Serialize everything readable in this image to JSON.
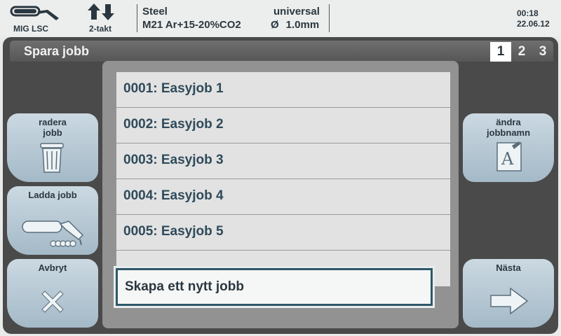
{
  "status_bar": {
    "process_mode": "MIG LSC",
    "trigger_mode": "2-takt",
    "material": "Steel",
    "gas": "M21 Ar+15-20%CO2",
    "program": "universal",
    "wire_symbol": "Ø",
    "wire_diameter": "1.0mm",
    "time": "00:18",
    "date": "22.06.12"
  },
  "header": {
    "title": "Spara jobb",
    "pages": [
      "1",
      "2",
      "3"
    ],
    "active_page": "1"
  },
  "left_buttons": {
    "delete_label": "radera\njobb",
    "load_label": "Ladda jobb",
    "cancel_label": "Avbryt"
  },
  "right_buttons": {
    "rename_label": "ändra\njobbnamn",
    "next_label": "Nästa"
  },
  "job_list": [
    "0001: Easyjob 1",
    "0002: Easyjob 2",
    "0003: Easyjob 3",
    "0004: Easyjob 4",
    "0005: Easyjob 5"
  ],
  "new_job_label": "Skapa ett nytt jobb",
  "icons": {
    "mode": "welding-torch-icon",
    "trigger": "up-down-arrows-icon",
    "delete": "trash-icon",
    "load": "torch-icon",
    "cancel": "close-icon",
    "rename": "edit-document-icon",
    "next": "arrow-right-icon"
  },
  "colors": {
    "panel": "#4a4a4a",
    "button": "#b7cad6",
    "text_dark": "#2b3740",
    "list_text": "#2f4a5a",
    "highlight_border": "#2f5868"
  }
}
